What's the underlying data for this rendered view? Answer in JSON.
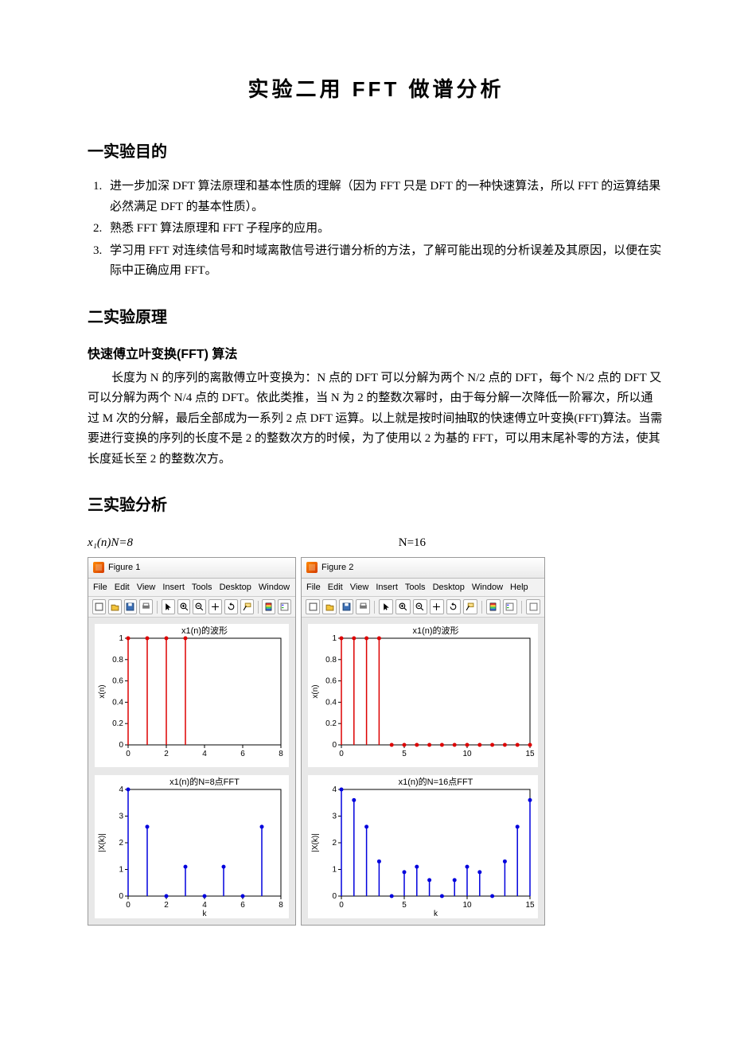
{
  "title": "实验二用 FFT  做谱分析",
  "s1_heading": "一实验目的",
  "objectives": [
    "进一步加深 DFT 算法原理和基本性质的理解（因为 FFT 只是 DFT 的一种快速算法，所以 FFT 的运算结果必然满足 DFT 的基本性质）。",
    "熟悉 FFT 算法原理和 FFT 子程序的应用。",
    "学习用 FFT 对连续信号和时域离散信号进行谱分析的方法，了解可能出现的分析误差及其原因，以便在实际中正确应用 FFT。"
  ],
  "s2_heading": "二实验原理",
  "s2_sub": "快速傅立叶变换(FFT) 算法",
  "s2_para": "长度为 N 的序列的离散傅立叶变换为：N 点的 DFT 可以分解为两个 N/2 点的 DFT，每个 N/2 点的 DFT 又可以分解为两个 N/4 点的 DFT。依此类推，当 N 为 2 的整数次幂时，由于每分解一次降低一阶幂次，所以通过 M 次的分解，最后全部成为一系列 2 点 DFT 运算。以上就是按时间抽取的快速傅立叶变换(FFT)算法。当需要进行变换的序列的长度不是 2 的整数次方的时候，为了使用以 2 为基的 FFT，可以用末尾补零的方法，使其长度延长至 2 的整数次方。",
  "s3_heading": "三实验分析",
  "label_n8": "x₁(n)N=8",
  "label_n16": "N=16",
  "fig1": {
    "title": "Figure 1",
    "menu": [
      "File",
      "Edit",
      "View",
      "Insert",
      "Tools",
      "Desktop",
      "Window"
    ]
  },
  "fig2": {
    "title": "Figure 2",
    "menu": [
      "File",
      "Edit",
      "View",
      "Insert",
      "Tools",
      "Desktop",
      "Window",
      "Help"
    ]
  },
  "chart_data": [
    {
      "type": "bar",
      "title": "x1(n)的波形",
      "xlabel": "",
      "ylabel": "x(n)",
      "xlim": [
        0,
        8
      ],
      "ylim": [
        0,
        1
      ],
      "xticks": [
        0,
        2,
        4,
        6,
        8
      ],
      "yticks": [
        0,
        0.2,
        0.4,
        0.6,
        0.8,
        1
      ],
      "x": [
        0,
        1,
        2,
        3
      ],
      "values": [
        1,
        1,
        1,
        1
      ],
      "color": "red"
    },
    {
      "type": "bar",
      "title": "x1(n)的N=8点FFT",
      "xlabel": "k",
      "ylabel": "|X(k)|",
      "xlim": [
        0,
        8
      ],
      "ylim": [
        0,
        4
      ],
      "xticks": [
        0,
        2,
        4,
        6,
        8
      ],
      "yticks": [
        0,
        1,
        2,
        3,
        4
      ],
      "x": [
        0,
        1,
        2,
        3,
        4,
        5,
        6,
        7
      ],
      "values": [
        4,
        2.6,
        0,
        1.1,
        0,
        1.1,
        0,
        2.6
      ],
      "color": "blue"
    },
    {
      "type": "bar",
      "title": "x1(n)的波形",
      "xlabel": "",
      "ylabel": "x(n)",
      "xlim": [
        0,
        15
      ],
      "ylim": [
        0,
        1
      ],
      "xticks": [
        0,
        5,
        10,
        15
      ],
      "yticks": [
        0,
        0.2,
        0.4,
        0.6,
        0.8,
        1
      ],
      "x": [
        0,
        1,
        2,
        3,
        4,
        5,
        6,
        7,
        8,
        9,
        10,
        11,
        12,
        13,
        14,
        15
      ],
      "values": [
        1,
        1,
        1,
        1,
        0,
        0,
        0,
        0,
        0,
        0,
        0,
        0,
        0,
        0,
        0,
        0
      ],
      "color": "red"
    },
    {
      "type": "bar",
      "title": "x1(n)的N=16点FFT",
      "xlabel": "k",
      "ylabel": "|X(k)|",
      "xlim": [
        0,
        15
      ],
      "ylim": [
        0,
        4
      ],
      "xticks": [
        0,
        5,
        10,
        15
      ],
      "yticks": [
        0,
        1,
        2,
        3,
        4
      ],
      "x": [
        0,
        1,
        2,
        3,
        4,
        5,
        6,
        7,
        8,
        9,
        10,
        11,
        12,
        13,
        14,
        15
      ],
      "values": [
        4,
        3.6,
        2.6,
        1.3,
        0,
        0.9,
        1.1,
        0.6,
        0,
        0.6,
        1.1,
        0.9,
        0,
        1.3,
        2.6,
        3.6
      ],
      "color": "blue"
    }
  ]
}
